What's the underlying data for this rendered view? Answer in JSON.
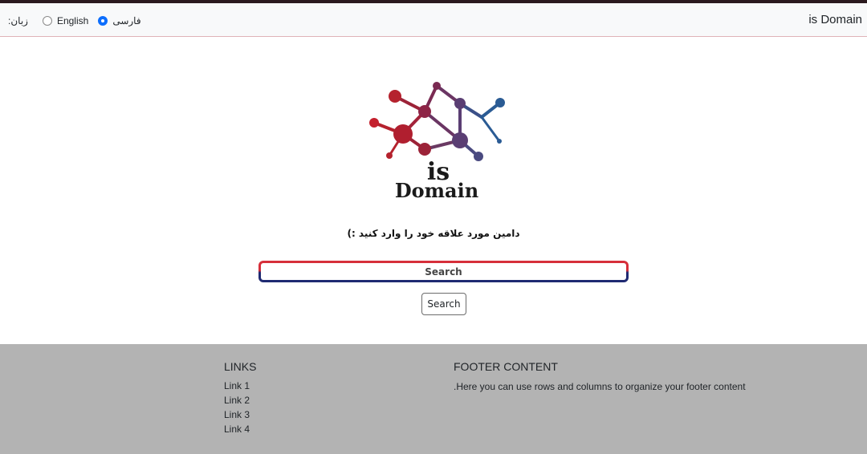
{
  "navbar": {
    "brand": "is Domain",
    "language_label": ":زبان",
    "languages": [
      {
        "label": "English",
        "selected": false
      },
      {
        "label": "فارسی",
        "selected": true
      }
    ]
  },
  "logo": {
    "line1": "is",
    "line2": "Domain",
    "colors": {
      "red": "#b5222e",
      "maroon": "#8e2446",
      "purple": "#5a3e73",
      "blue": "#2a5b94"
    }
  },
  "main": {
    "prompt": "دامین مورد علاقه خود را وارد کنید :)",
    "search_placeholder": "Search",
    "search_button": "Search"
  },
  "footer": {
    "links_title": "LINKS",
    "links": [
      "Link 1",
      "Link 2",
      "Link 3",
      "Link 4"
    ],
    "content_title": "FOOTER CONTENT",
    "content_text": ".Here you can use rows and columns to organize your footer content"
  }
}
